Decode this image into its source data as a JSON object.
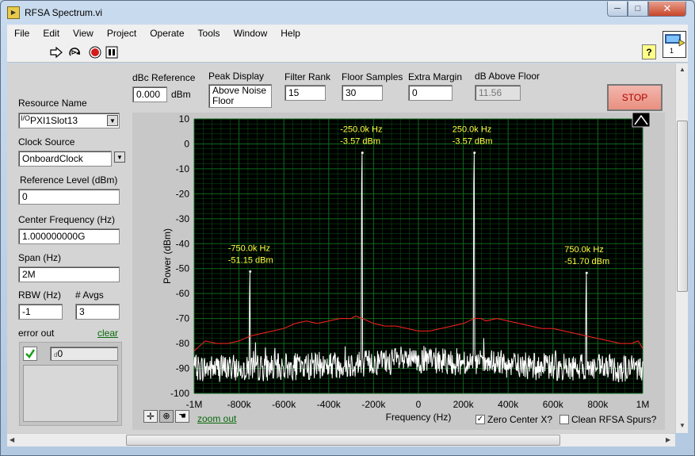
{
  "window": {
    "title": "RFSA Spectrum.vi",
    "min": "─",
    "max": "□",
    "close": "✕"
  },
  "menu": [
    "File",
    "Edit",
    "View",
    "Project",
    "Operate",
    "Tools",
    "Window",
    "Help"
  ],
  "toolbar": {
    "help": "?",
    "vi_icon_label": "1"
  },
  "controls": {
    "dbc_reference": {
      "label": "dBc Reference",
      "value": "0.000",
      "unit": "dBm"
    },
    "peak_display": {
      "label": "Peak Display",
      "value_line1": "Above Noise",
      "value_line2": "Floor"
    },
    "filter_rank": {
      "label": "Filter Rank",
      "value": "15"
    },
    "floor_samples": {
      "label": "Floor Samples",
      "value": "30"
    },
    "extra_margin": {
      "label": "Extra Margin",
      "value": "0"
    },
    "db_above_floor": {
      "label": "dB Above Floor",
      "value": "11.56"
    },
    "stop": "STOP",
    "resource_name": {
      "label": "Resource Name",
      "value": "PXI1Slot13"
    },
    "clock_source": {
      "label": "Clock Source",
      "value": "OnboardClock"
    },
    "reference_level": {
      "label": "Reference Level (dBm)",
      "value": "0"
    },
    "center_frequency": {
      "label": "Center Frequency (Hz)",
      "value": "1.000000000G"
    },
    "span": {
      "label": "Span (Hz)",
      "value": "2M"
    },
    "rbw": {
      "label": "RBW (Hz)",
      "value": "-1"
    },
    "avgs": {
      "label": "# Avgs",
      "value": "3"
    },
    "error_out": {
      "label": "error out",
      "clear": "clear",
      "code": "0"
    }
  },
  "graph_footer": {
    "zoom_out": "zoom out",
    "zero_center": "Zero Center X?",
    "clean_spurs": "Clean RFSA Spurs?"
  },
  "colors": {
    "plot_bg": "#000000",
    "grid": "#0d6b1a",
    "trace": "#ffffff",
    "floor": "#ff2020",
    "annotation": "#ffff40",
    "stop_text": "#b00000"
  },
  "chart_data": {
    "type": "line",
    "xlabel": "Frequency (Hz)",
    "ylabel": "Power (dBm)",
    "xlim": [
      -1000000,
      1000000
    ],
    "ylim": [
      -100,
      10
    ],
    "x_ticks": [
      -1000000,
      -800000,
      -600000,
      -400000,
      -200000,
      0,
      200000,
      400000,
      600000,
      800000,
      1000000
    ],
    "x_tick_labels": [
      "-1M",
      "-800k",
      "-600k",
      "-400k",
      "-200k",
      "0",
      "200k",
      "400k",
      "600k",
      "800k",
      "1M"
    ],
    "y_ticks": [
      10,
      0,
      -10,
      -20,
      -30,
      -40,
      -50,
      -60,
      -70,
      -80,
      -90,
      -100
    ],
    "grid": true,
    "series": [
      {
        "x": [
          -1000000,
          -950000,
          -900000,
          -850000,
          -800000,
          -750000,
          -700000,
          -650000,
          -600000,
          -550000,
          -500000,
          -450000,
          -400000,
          -350000,
          -300000,
          -280000,
          -250000,
          -200000,
          -150000,
          -100000,
          -50000,
          0,
          50000,
          100000,
          150000,
          200000,
          250000,
          280000,
          300000,
          350000,
          400000,
          450000,
          500000,
          550000,
          600000,
          650000,
          700000,
          750000,
          800000,
          850000,
          900000,
          950000,
          980000,
          1000000
        ],
        "values": [
          -83,
          -79,
          -80,
          -80,
          -79,
          -77,
          -76,
          -75,
          -74,
          -72,
          -71,
          -72,
          -71,
          -70,
          -70,
          -69,
          -70,
          -72,
          -73,
          -73,
          -74,
          -75,
          -75,
          -74,
          -73,
          -72,
          -70,
          -70,
          -71,
          -70,
          -71,
          -72,
          -73,
          -74,
          -74,
          -75,
          -76,
          -77,
          -78,
          -79,
          -80,
          -80,
          -79,
          -82
        ]
      },
      {
        "peaks": [
          {
            "x": -750000,
            "y": -51.15,
            "label_freq": "-750.0k Hz",
            "label_power": "-51.15 dBm"
          },
          {
            "x": -250000,
            "y": -3.57,
            "label_freq": "-250.0k Hz",
            "label_power": "-3.57 dBm"
          },
          {
            "x": 250000,
            "y": -3.57,
            "label_freq": "250.0k Hz",
            "label_power": "-3.57 dBm"
          },
          {
            "x": 750000,
            "y": -51.7,
            "label_freq": "750.0k Hz",
            "label_power": "-51.70 dBm"
          }
        ],
        "noise_floor": -90
      }
    ]
  }
}
